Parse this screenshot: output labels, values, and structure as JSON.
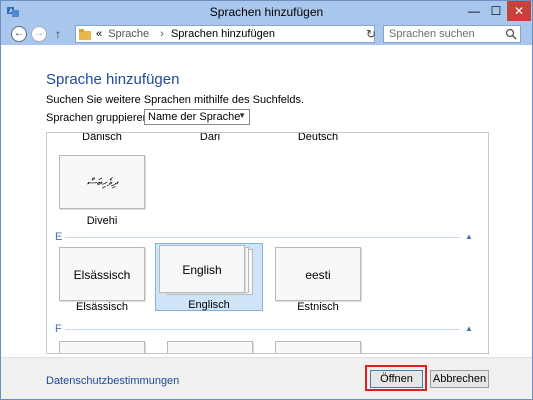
{
  "window": {
    "title": "Sprachen hinzufügen",
    "min_glyph": "—",
    "max_glyph": "☐",
    "close_glyph": "✕"
  },
  "nav": {
    "back_glyph": "←",
    "forward_glyph": "→",
    "up_glyph": "↑"
  },
  "address": {
    "prefix": "«",
    "crumbs": [
      "Sprache",
      "Sprachen hinzufügen"
    ],
    "separator": "›",
    "dropdown_glyph": "▾",
    "refresh_glyph": "↻"
  },
  "search": {
    "placeholder": "Sprachen suchen"
  },
  "main": {
    "heading": "Sprache hinzufügen",
    "instruction": "Suchen Sie weitere Sprachen mithilfe des Suchfelds.",
    "group_by_label": "Sprachen gruppieren nach:",
    "group_by_value": "Name der Sprache"
  },
  "languages": {
    "top_row_labels": [
      "Dänisch",
      "Dari",
      "Deutsch"
    ],
    "divehi": {
      "tile": "ދިވެހިބަސް",
      "label": "Divehi"
    },
    "group_e": "E",
    "group_f": "F",
    "e_items": [
      {
        "tile": "Elsässisch",
        "label": "Elsässisch"
      },
      {
        "tile": "English",
        "label": "Englisch"
      },
      {
        "tile": "eesti",
        "label": "Estnisch"
      }
    ]
  },
  "footer": {
    "privacy_link": "Datenschutzbestimmungen",
    "open_button": "Öffnen",
    "cancel_button": "Abbrechen"
  },
  "colors": {
    "titlebar": "#a9c6ec",
    "accent": "#1e4a9e",
    "selection": "#d0e4f8",
    "highlight": "#e02020"
  },
  "icons": [
    "app-icon",
    "back-icon",
    "forward-icon",
    "up-icon",
    "folder-icon",
    "refresh-icon",
    "search-icon",
    "collapse-icon"
  ]
}
